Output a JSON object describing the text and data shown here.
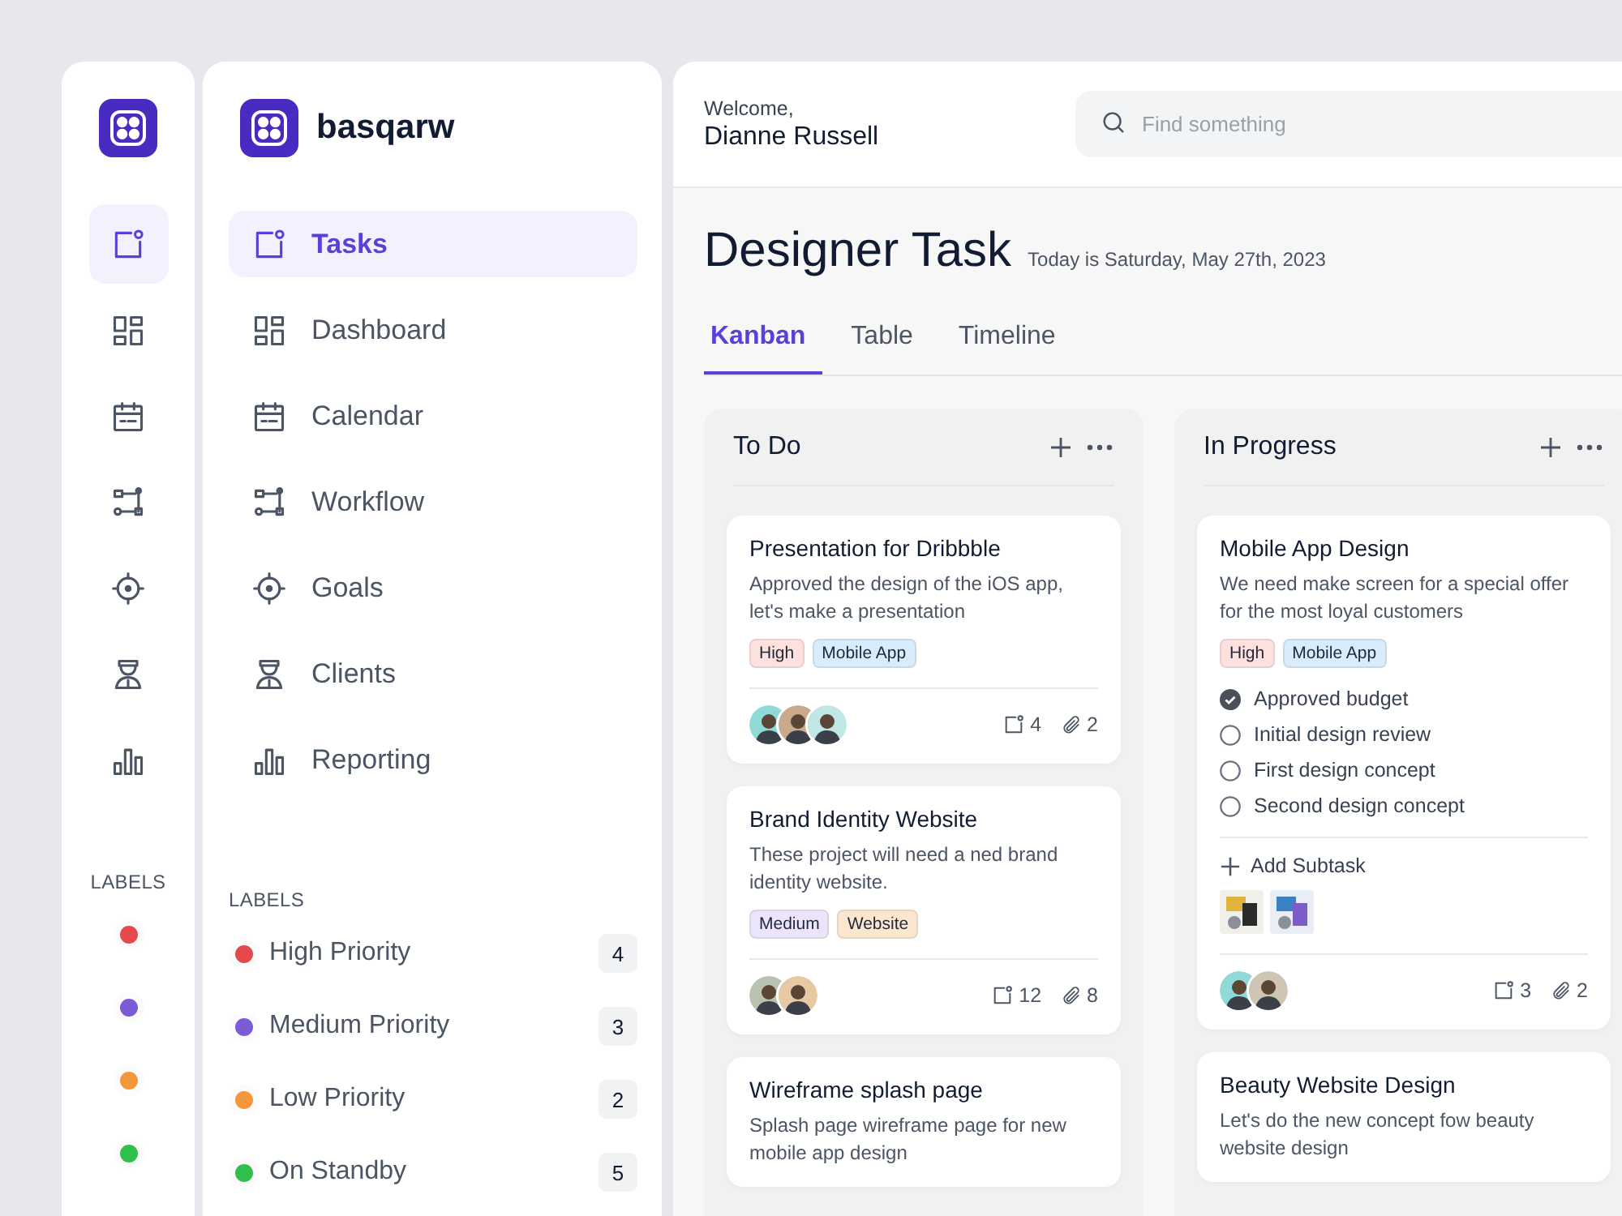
{
  "rail": {
    "items": [
      {
        "selected": true
      },
      {
        "selected": false
      },
      {
        "selected": false
      },
      {
        "selected": false
      },
      {
        "selected": false
      },
      {
        "selected": false
      },
      {
        "selected": false
      }
    ],
    "labels_heading": "LABELS"
  },
  "sidebar": {
    "brand": "basqarw",
    "nav": [
      {
        "label": "Tasks",
        "selected": true
      },
      {
        "label": "Dashboard",
        "selected": false
      },
      {
        "label": "Calendar",
        "selected": false
      },
      {
        "label": "Workflow",
        "selected": false
      },
      {
        "label": "Goals",
        "selected": false
      },
      {
        "label": "Clients",
        "selected": false
      },
      {
        "label": "Reporting",
        "selected": false
      }
    ],
    "labels_heading": "LABELS",
    "labels": [
      {
        "name": "High Priority",
        "count": "4",
        "color": "#e5484d"
      },
      {
        "name": "Medium Priority",
        "count": "3",
        "color": "#7b5cd6"
      },
      {
        "name": "Low Priority",
        "count": "2",
        "color": "#f5963a"
      },
      {
        "name": "On Standby",
        "count": "5",
        "color": "#2fbf4a"
      }
    ]
  },
  "header": {
    "welcome": "Welcome,",
    "user": "Dianne Russell",
    "search": {
      "placeholder": "Find something"
    }
  },
  "page": {
    "title": "Designer Task",
    "date": "Today is Saturday, May 27th, 2023",
    "tabs": [
      {
        "label": "Kanban",
        "selected": true
      },
      {
        "label": "Table",
        "selected": false
      },
      {
        "label": "Timeline",
        "selected": false
      }
    ]
  },
  "board": {
    "columns": [
      {
        "title": "To Do",
        "cards": [
          {
            "title": "Presentation for Dribbble",
            "description": "Approved the design of the iOS app, let's make a presentation",
            "tags": [
              {
                "text": "High",
                "color": "#fde0e0"
              },
              {
                "text": "Mobile App",
                "color": "#d8ecfb"
              }
            ],
            "avatars": [
              {
                "color": "#8fdad6"
              },
              {
                "color": "#c9a98c"
              },
              {
                "color": "#bfe7e4"
              }
            ],
            "subtasks_count": "4",
            "attachments_count": "2"
          },
          {
            "title": "Brand Identity Website",
            "description": "These project will need a ned brand identity website.",
            "tags": [
              {
                "text": "Medium",
                "color": "#ece4fb"
              },
              {
                "text": "Website",
                "color": "#fbe6cf"
              }
            ],
            "avatars": [
              {
                "color": "#b9c2b0"
              },
              {
                "color": "#e7c9a4"
              }
            ],
            "subtasks_count": "12",
            "attachments_count": "8"
          },
          {
            "title": "Wireframe splash page",
            "description": "Splash page wireframe page for new mobile app design"
          }
        ]
      },
      {
        "title": "In Progress",
        "cards": [
          {
            "title": "Mobile App Design",
            "description": "We need make screen for a special offer for the most loyal customers",
            "tags": [
              {
                "text": "High",
                "color": "#fde0e0"
              },
              {
                "text": "Mobile App",
                "color": "#d8ecfb"
              }
            ],
            "subtasks": [
              {
                "text": "Approved budget",
                "checked": true
              },
              {
                "text": "Initial design review",
                "checked": false
              },
              {
                "text": "First design concept",
                "checked": false
              },
              {
                "text": "Second design concept",
                "checked": false
              }
            ],
            "add_subtask": "Add Subtask",
            "attachments": [
              {
                "kind": "picture"
              },
              {
                "kind": "picture"
              }
            ],
            "avatars": [
              {
                "color": "#8fdad6"
              },
              {
                "color": "#cfc5b4"
              }
            ],
            "subtasks_count": "3",
            "attachments_count": "2"
          },
          {
            "title": "Beauty Website Design",
            "description": "Let's do the new concept fow beauty website design"
          }
        ]
      }
    ]
  }
}
